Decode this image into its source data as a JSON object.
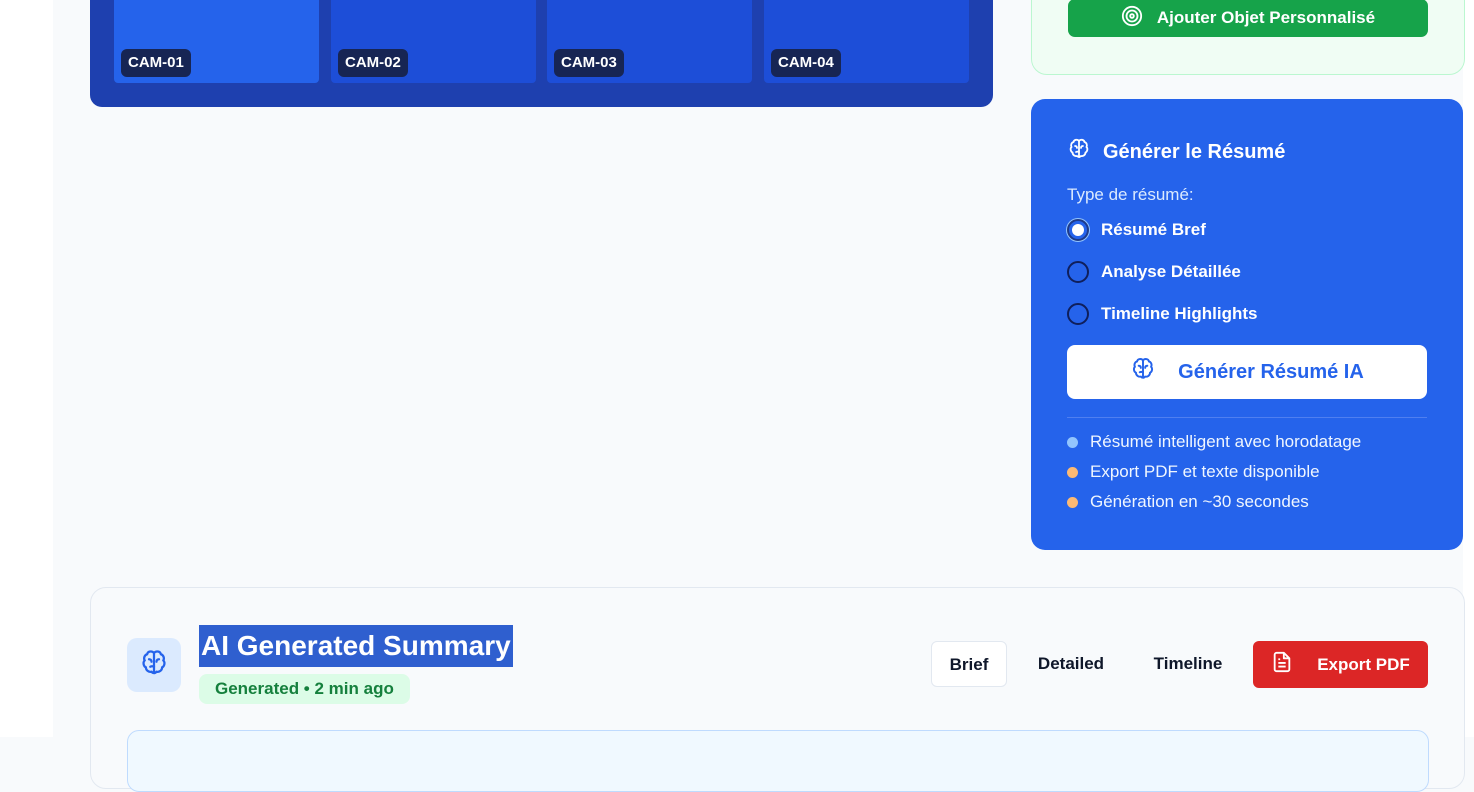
{
  "cameras": [
    {
      "label": "CAM-01"
    },
    {
      "label": "CAM-02"
    },
    {
      "label": "CAM-03"
    },
    {
      "label": "CAM-04"
    }
  ],
  "custom_object": {
    "button_label": "Ajouter Objet Personnalisé",
    "icon": "target-icon"
  },
  "summary_card": {
    "title": "Générer le Résumé",
    "type_label": "Type de résumé:",
    "options": [
      {
        "label": "Résumé Bref",
        "selected": true
      },
      {
        "label": "Analyse Détaillée",
        "selected": false
      },
      {
        "label": "Timeline Highlights",
        "selected": false
      }
    ],
    "generate_button": "Générer Résumé IA",
    "features": [
      {
        "text": "Résumé intelligent avec horodatage",
        "color": "#93c5fd"
      },
      {
        "text": "Export PDF et texte disponible",
        "color": "#fdba74"
      },
      {
        "text": "Génération en ~30 secondes",
        "color": "#fdba74"
      }
    ]
  },
  "ai_summary": {
    "title": "AI Generated Summary",
    "badge": "Generated • 2 min ago",
    "tabs": [
      {
        "label": "Brief",
        "active": true
      },
      {
        "label": "Detailed",
        "active": false
      },
      {
        "label": "Timeline",
        "active": false
      }
    ],
    "export_label": "Export PDF"
  },
  "colors": {
    "primary": "#2563eb",
    "success": "#16a34a",
    "danger": "#dc2626",
    "panel_dark": "#1e40af"
  }
}
